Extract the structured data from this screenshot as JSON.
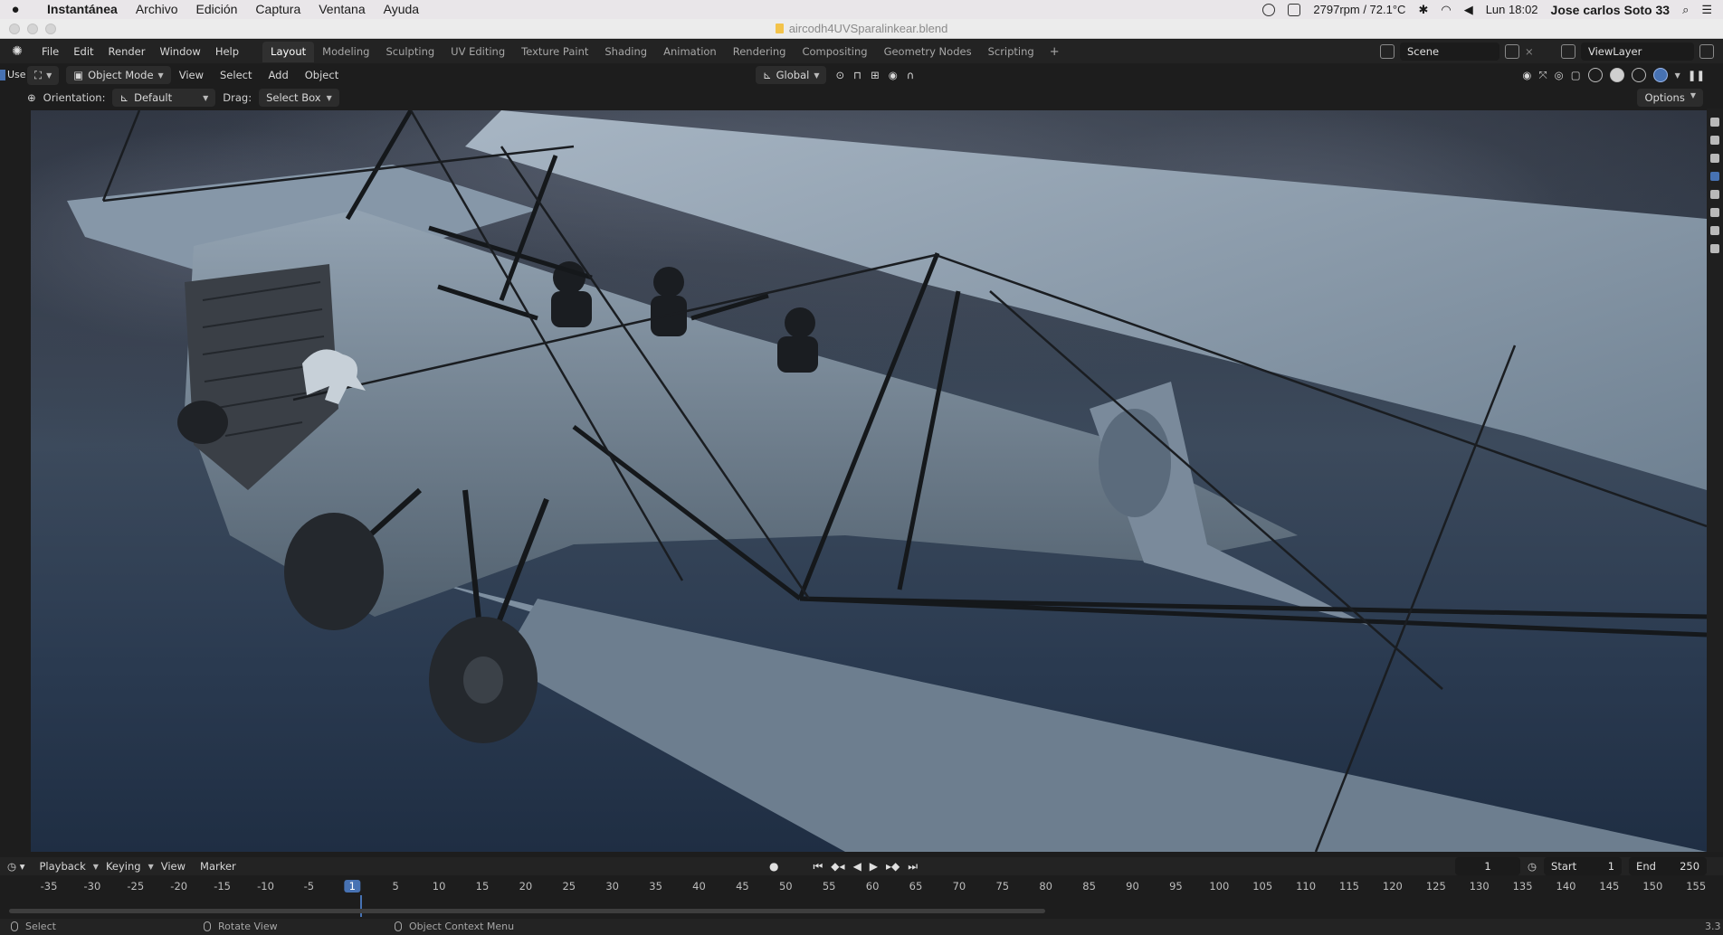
{
  "mac": {
    "app_name": "Instantánea",
    "menus": [
      "Archivo",
      "Edición",
      "Captura",
      "Ventana",
      "Ayuda"
    ],
    "fan_status": "2797rpm / 72.1°C",
    "clock": "Lun 18:02",
    "user": "Jose carlos Soto 33"
  },
  "window": {
    "title": "aircodh4UVSparalinkear.blend"
  },
  "topbar": {
    "menus": [
      "File",
      "Edit",
      "Render",
      "Window",
      "Help"
    ],
    "workspaces": [
      "Layout",
      "Modeling",
      "Sculpting",
      "UV Editing",
      "Texture Paint",
      "Shading",
      "Animation",
      "Rendering",
      "Compositing",
      "Geometry Nodes",
      "Scripting"
    ],
    "active_workspace": "Layout",
    "add_tab": "+",
    "scene": "Scene",
    "view_layer": "ViewLayer"
  },
  "header": {
    "mode": "Object Mode",
    "menus": [
      "View",
      "Select",
      "Add",
      "Object"
    ],
    "transform_orientation": "Global"
  },
  "toolsettings": {
    "use_label": "Use",
    "orientation_label": "Orientation:",
    "orientation_value": "Default",
    "drag_label": "Drag:",
    "drag_value": "Select Box",
    "options": "Options"
  },
  "timeline": {
    "menus": [
      "Playback",
      "Keying",
      "View",
      "Marker"
    ],
    "current_frame": "1",
    "start_label": "Start",
    "start": "1",
    "end_label": "End",
    "end": "250",
    "ticks": [
      "-35",
      "-30",
      "-25",
      "-20",
      "-15",
      "-10",
      "-5",
      "1",
      "5",
      "10",
      "15",
      "20",
      "25",
      "30",
      "35",
      "40",
      "45",
      "50",
      "55",
      "60",
      "65",
      "70",
      "75",
      "80",
      "85",
      "90",
      "95",
      "100",
      "105",
      "110",
      "115",
      "120",
      "125",
      "130",
      "135",
      "140",
      "145",
      "150",
      "155"
    ]
  },
  "status": {
    "select": "Select",
    "rotate": "Rotate View",
    "context": "Object Context Menu",
    "version": "3.3"
  },
  "colors": {
    "accent": "#4772b3",
    "sky_top": "#2e3440",
    "sky_bottom": "#1f2e43",
    "plane_body": "#8ea0b0"
  }
}
